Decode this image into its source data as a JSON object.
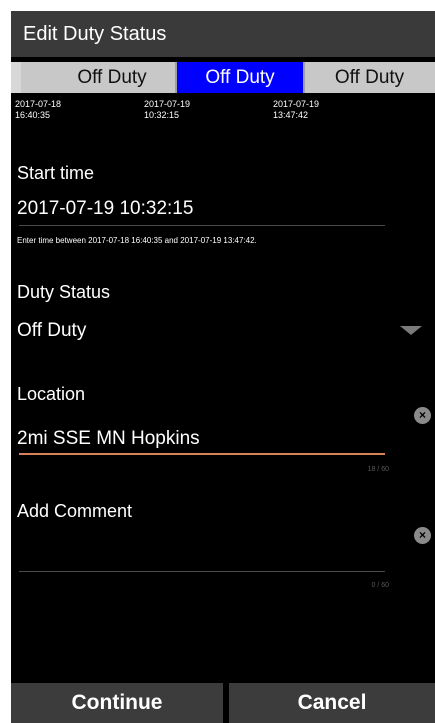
{
  "title": "Edit Duty Status",
  "timeline": {
    "segments": [
      "Off Duty",
      "Off Duty",
      "Off Duty"
    ],
    "selected_index": 1,
    "timestamps": [
      {
        "date": "2017-07-18",
        "time": "16:40:35"
      },
      {
        "date": "2017-07-19",
        "time": "10:32:15"
      },
      {
        "date": "2017-07-19",
        "time": "13:47:42"
      }
    ]
  },
  "start_time": {
    "label": "Start time",
    "value": "2017-07-19 10:32:15",
    "hint": "Enter time between 2017-07-18 16:40:35 and 2017-07-19 13:47:42."
  },
  "duty_status": {
    "label": "Duty Status",
    "value": "Off Duty"
  },
  "location": {
    "label": "Location",
    "value": "2mi SSE MN Hopkins",
    "counter": "18 / 60"
  },
  "comment": {
    "label": "Add Comment",
    "value": "",
    "counter": "0 / 60"
  },
  "buttons": {
    "continue": "Continue",
    "cancel": "Cancel"
  },
  "colors": {
    "accent_blue": "#0000ff",
    "active_underline": "#d7815a",
    "title_bar": "#3a3a3a"
  }
}
